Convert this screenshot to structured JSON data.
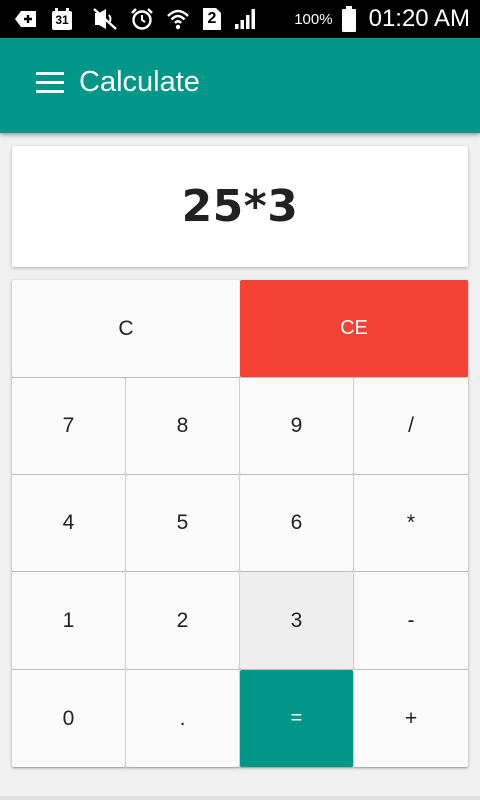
{
  "status_bar": {
    "calendar_date": "31",
    "sim_slot": "2",
    "battery_percent": "100%",
    "time": "01:20 AM",
    "icons": [
      "add-notification-icon",
      "calendar-icon",
      "mute-icon",
      "alarm-icon",
      "wifi-icon",
      "sim-icon",
      "signal-icon",
      "battery-icon"
    ]
  },
  "app_bar": {
    "title": "Calculate",
    "menu_icon": "hamburger-menu-icon"
  },
  "display": {
    "expression": "25*3"
  },
  "keypad": {
    "clear_label": "C",
    "clear_entry_label": "CE",
    "rows": [
      [
        "7",
        "8",
        "9",
        "/"
      ],
      [
        "4",
        "5",
        "6",
        "*"
      ],
      [
        "1",
        "2",
        "3",
        "-"
      ],
      [
        "0",
        ".",
        "=",
        "+"
      ]
    ],
    "pressed_key": "3"
  },
  "colors": {
    "primary": "#009688",
    "clear_entry": "#f44336",
    "key_background": "#fafafa",
    "pressed_key_background": "#eeeeee"
  }
}
